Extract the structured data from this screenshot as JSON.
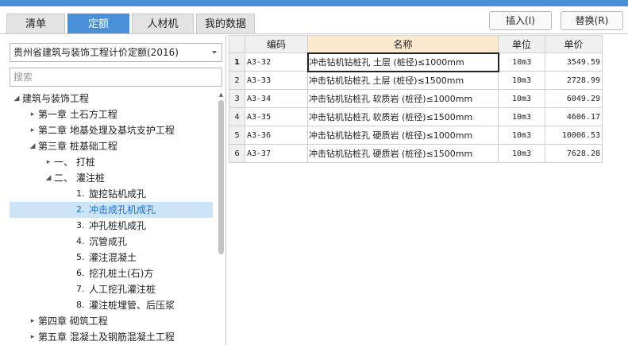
{
  "tabs": [
    "清单",
    "定额",
    "人材机",
    "我的数据"
  ],
  "active_tab": 1,
  "toolbar": {
    "insert_label": "插入(I)",
    "replace_label": "替换(R)"
  },
  "left": {
    "quota_library": "贵州省建筑与装饰工程计价定额(2016)",
    "search_placeholder": "搜索"
  },
  "tree": [
    {
      "label": "建筑与装饰工程",
      "toggle": "expanded"
    },
    {
      "label": "第一章 土石方工程",
      "toggle": "collapsed"
    },
    {
      "label": "第二章 地基处理及基坑支护工程",
      "toggle": "collapsed"
    },
    {
      "label": "第三章 桩基础工程",
      "toggle": "expanded"
    },
    {
      "label": "一、 打桩",
      "toggle": "collapsed"
    },
    {
      "label": "二、 灌注桩",
      "toggle": "expanded"
    },
    {
      "num": "1.",
      "label": "旋挖钻机成孔"
    },
    {
      "num": "2.",
      "label": "冲击成孔机成孔",
      "selected": true
    },
    {
      "num": "3.",
      "label": "冲孔桩机成孔"
    },
    {
      "num": "4.",
      "label": "沉管成孔"
    },
    {
      "num": "5.",
      "label": "灌注混凝土"
    },
    {
      "num": "6.",
      "label": "挖孔桩土(石)方"
    },
    {
      "num": "7.",
      "label": "人工挖孔灌注桩"
    },
    {
      "num": "8.",
      "label": "灌注桩埋管、后压浆"
    },
    {
      "label": "第四章 砌筑工程",
      "toggle": "collapsed"
    },
    {
      "label": "第五章 混凝土及钢筋混凝土工程",
      "toggle": "collapsed"
    }
  ],
  "table": {
    "headers": {
      "code": "编码",
      "name": "名称",
      "unit": "单位",
      "price": "单价"
    },
    "rows": [
      {
        "no": "1",
        "code": "A3-32",
        "name": "冲击钻机钻桩孔 土层 (桩径)≤1000mm",
        "unit": "10m3",
        "price": "3549.59"
      },
      {
        "no": "2",
        "code": "A3-33",
        "name": "冲击钻机钻桩孔 土层 (桩径)≤1500mm",
        "unit": "10m3",
        "price": "2728.99"
      },
      {
        "no": "3",
        "code": "A3-34",
        "name": "冲击钻机钻桩孔 软质岩 (桩径)≤1000mm",
        "unit": "10m3",
        "price": "6049.29"
      },
      {
        "no": "4",
        "code": "A3-35",
        "name": "冲击钻机钻桩孔 软质岩 (桩径)≤1500mm",
        "unit": "10m3",
        "price": "4606.17"
      },
      {
        "no": "5",
        "code": "A3-36",
        "name": "冲击钻机钻桩孔 硬质岩 (桩径)≤1000mm",
        "unit": "10m3",
        "price": "10006.53"
      },
      {
        "no": "6",
        "code": "A3-37",
        "name": "冲击钻机钻桩孔 硬质岩 (桩径)≤1500mm",
        "unit": "10m3",
        "price": "7628.28"
      }
    ],
    "current_row": 0
  },
  "icons": {
    "expanded": "triangle-down-icon",
    "collapsed": "triangle-right-icon",
    "dropdown": "chevron-down-icon"
  },
  "colors": {
    "accent": "#4a90d9",
    "selected_bg": "#cce4f7",
    "selected_text": "#1a6fd1",
    "name_header_bg": "#fde9cf"
  }
}
